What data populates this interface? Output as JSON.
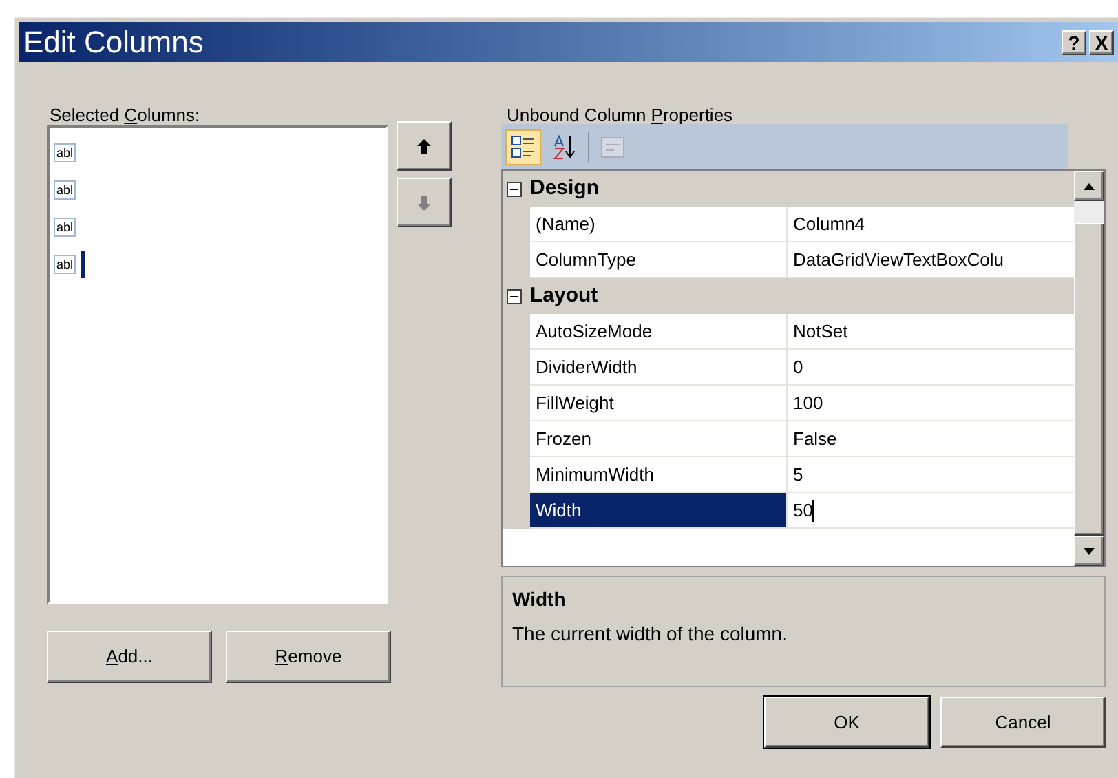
{
  "window": {
    "title": "Edit Columns",
    "title_buttons": [
      "?",
      "X"
    ]
  },
  "selected_columns": {
    "label": {
      "before": "Selected ",
      "key": "C",
      "after": "olumns:"
    },
    "items": [
      {
        "icon_text": "abl",
        "editing": false
      },
      {
        "icon_text": "abl",
        "editing": false
      },
      {
        "icon_text": "abl",
        "editing": false
      },
      {
        "icon_text": "abl",
        "editing": true
      }
    ],
    "move_buttons": [
      {
        "kind": "up",
        "disabled": false
      },
      {
        "kind": "down",
        "disabled": true
      }
    ],
    "buttons": [
      {
        "key": "A",
        "after": "dd..."
      },
      {
        "key": "R",
        "after": "emove"
      }
    ]
  },
  "properties": {
    "label": {
      "before": "Unbound Column ",
      "key": "P",
      "after": "roperties"
    },
    "toolbar": [
      {
        "kind": "categorized",
        "selected": true,
        "disabled": false
      },
      {
        "kind": "alphabetical",
        "selected": false,
        "disabled": false
      },
      {
        "kind": "pages",
        "selected": false,
        "disabled": true
      }
    ],
    "categories": [
      {
        "name": "Design",
        "expanded": true,
        "rows": [
          {
            "name": "(Name)",
            "value": "Column4",
            "selected": false
          },
          {
            "name": "ColumnType",
            "value": "DataGridViewTextBoxColu",
            "selected": false
          }
        ]
      },
      {
        "name": "Layout",
        "expanded": true,
        "rows": [
          {
            "name": "AutoSizeMode",
            "value": "NotSet",
            "selected": false
          },
          {
            "name": "DividerWidth",
            "value": "0",
            "selected": false
          },
          {
            "name": "FillWeight",
            "value": "100",
            "selected": false
          },
          {
            "name": "Frozen",
            "value": "False",
            "selected": false
          },
          {
            "name": "MinimumWidth",
            "value": "5",
            "selected": false
          },
          {
            "name": "Width",
            "value": "50",
            "selected": true
          }
        ]
      }
    ],
    "description": {
      "title": "Width",
      "text": "The current width of the column."
    }
  },
  "footer_buttons": [
    "OK",
    "Cancel"
  ]
}
